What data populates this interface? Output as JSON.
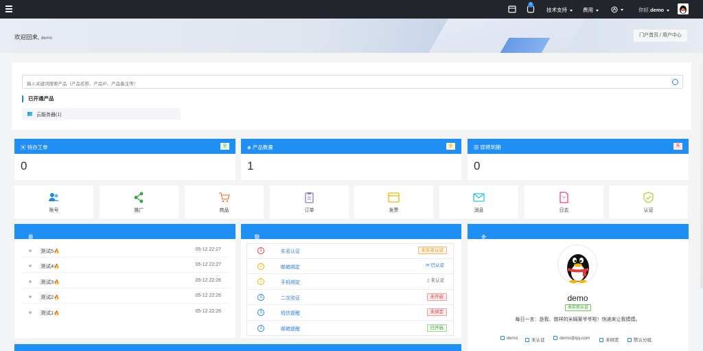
{
  "topbar": {
    "notification_count": "0",
    "support_label": "技术支持",
    "fee_label": "费用",
    "greeting": "你好,",
    "username": "demo"
  },
  "hero": {
    "welcome": "欢迎回来,",
    "welcome_user": "demo",
    "breadcrumb": "门户首页 / 用户中心"
  },
  "search": {
    "placeholder": "输入关键词搜索产品（产品名称、产品IP、产品备注等）"
  },
  "opened_products": {
    "title": "已开通产品",
    "items": [
      {
        "label": "云服务器(1)"
      }
    ]
  },
  "stats": [
    {
      "label": "待办工单",
      "tag": "全",
      "value": "0"
    },
    {
      "label": "产品数量",
      "tag": "全",
      "value": "1"
    },
    {
      "label": "即将到期",
      "tag": "天",
      "value": "0"
    }
  ],
  "quick_links": [
    {
      "label": "账号",
      "icon": "users-icon"
    },
    {
      "label": "推广",
      "icon": "share-icon"
    },
    {
      "label": "商品",
      "icon": "cart-icon"
    },
    {
      "label": "订单",
      "icon": "clipboard-icon"
    },
    {
      "label": "发票",
      "icon": "invoice-icon"
    },
    {
      "label": "消息",
      "icon": "mail-icon"
    },
    {
      "label": "日志",
      "icon": "log-icon"
    },
    {
      "label": "认证",
      "icon": "shield-check-icon"
    }
  ],
  "notices": {
    "title": "最新通知",
    "items": [
      {
        "title": "测试5",
        "date": "05-12 22:27"
      },
      {
        "title": "测试4",
        "date": "05-12 22:27"
      },
      {
        "title": "测试3",
        "date": "05-12 22:26"
      },
      {
        "title": "测试2",
        "date": "05-12 22:26"
      },
      {
        "title": "测试1",
        "date": "05-12 22:26"
      }
    ]
  },
  "security": {
    "title": "账户安全",
    "items": [
      {
        "num": "1",
        "label": "实名认证",
        "status": "未实名认证",
        "color": "#ff8a00"
      },
      {
        "num": "2",
        "label": "邮箱绑定",
        "status": "已认证",
        "color": "#1e6fd9"
      },
      {
        "num": "2",
        "label": "手机绑定",
        "status": "未认证",
        "color": "#666666"
      },
      {
        "num": "3",
        "label": "二次验证",
        "status": "未开启",
        "color": "#e53935"
      },
      {
        "num": "3",
        "label": "短信提醒",
        "status": "未绑定",
        "color": "#e53935"
      },
      {
        "num": "3",
        "label": "邮箱提醒",
        "status": "已开启",
        "color": "#43a047"
      }
    ]
  },
  "profile": {
    "title": "个人信息",
    "name": "demo",
    "badge": "未实名认证",
    "motto": "每日一言：是我、慈祥的米姆莱爷爷啦！快递来让我摸摸。",
    "info": [
      "demo",
      "未认证",
      "demo@qq.com",
      "未绑定",
      "默认分组"
    ]
  },
  "colors": {
    "primary": "#1f8ff5",
    "topbar": "#22252b"
  }
}
